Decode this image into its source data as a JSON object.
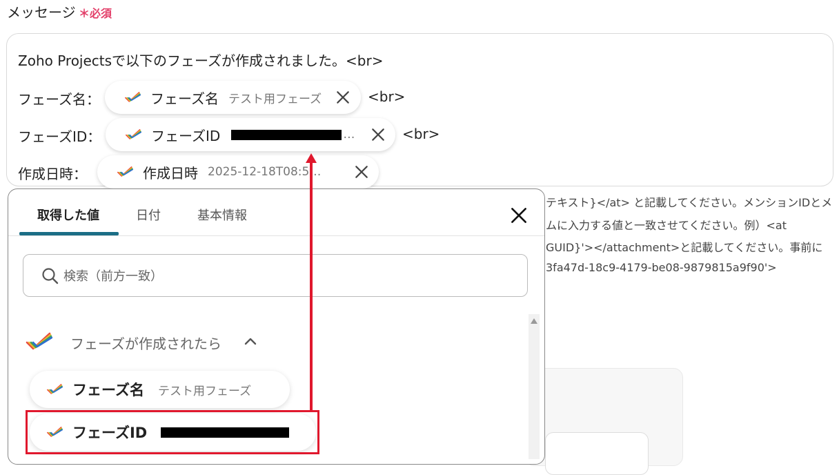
{
  "field": {
    "label": "メッセージ",
    "required_mark": "＊",
    "required_text": "必須"
  },
  "editor": {
    "line1": "Zoho Projectsで以下のフェーズが作成されました。<br>",
    "rows": [
      {
        "label": "フェーズ名：",
        "pill_name": "フェーズ名",
        "pill_value": "テスト用フェーズ",
        "suffix": "<br>"
      },
      {
        "label": "フェーズID：",
        "pill_name": "フェーズID",
        "pill_value": "…",
        "suffix": "<br>"
      },
      {
        "label": "作成日時：",
        "pill_name": "作成日時",
        "pill_value": "2025-12-18T08:5…"
      }
    ]
  },
  "help": {
    "lines": [
      "テキスト}</at> と記載してください。メンションIDとメ",
      "ムに入力する値と一致させてください。例）<at",
      "GUID}'></attachment>と記載してください。事前に",
      "3fa47d-18c9-4179-be08-9879815a9f90'>"
    ]
  },
  "picker": {
    "tabs": [
      {
        "label": "取得した値",
        "active": true
      },
      {
        "label": "日付",
        "active": false
      },
      {
        "label": "基本情報",
        "active": false
      }
    ],
    "search_placeholder": "検索（前方一致）",
    "group_title": "フェーズが作成されたら",
    "items": [
      {
        "name": "フェーズ名",
        "value": "テスト用フェーズ"
      },
      {
        "name": "フェーズID",
        "value": ""
      }
    ]
  },
  "icons": {
    "close": "close-icon",
    "search": "search-icon",
    "zoho": "zoho-projects-icon",
    "chevron": "chevron-up-icon",
    "scroll_up": "scroll-up-arrow-icon"
  },
  "colors": {
    "required": "#e3406a",
    "tab_active": "#1b6e86",
    "highlight": "#e0182d"
  }
}
